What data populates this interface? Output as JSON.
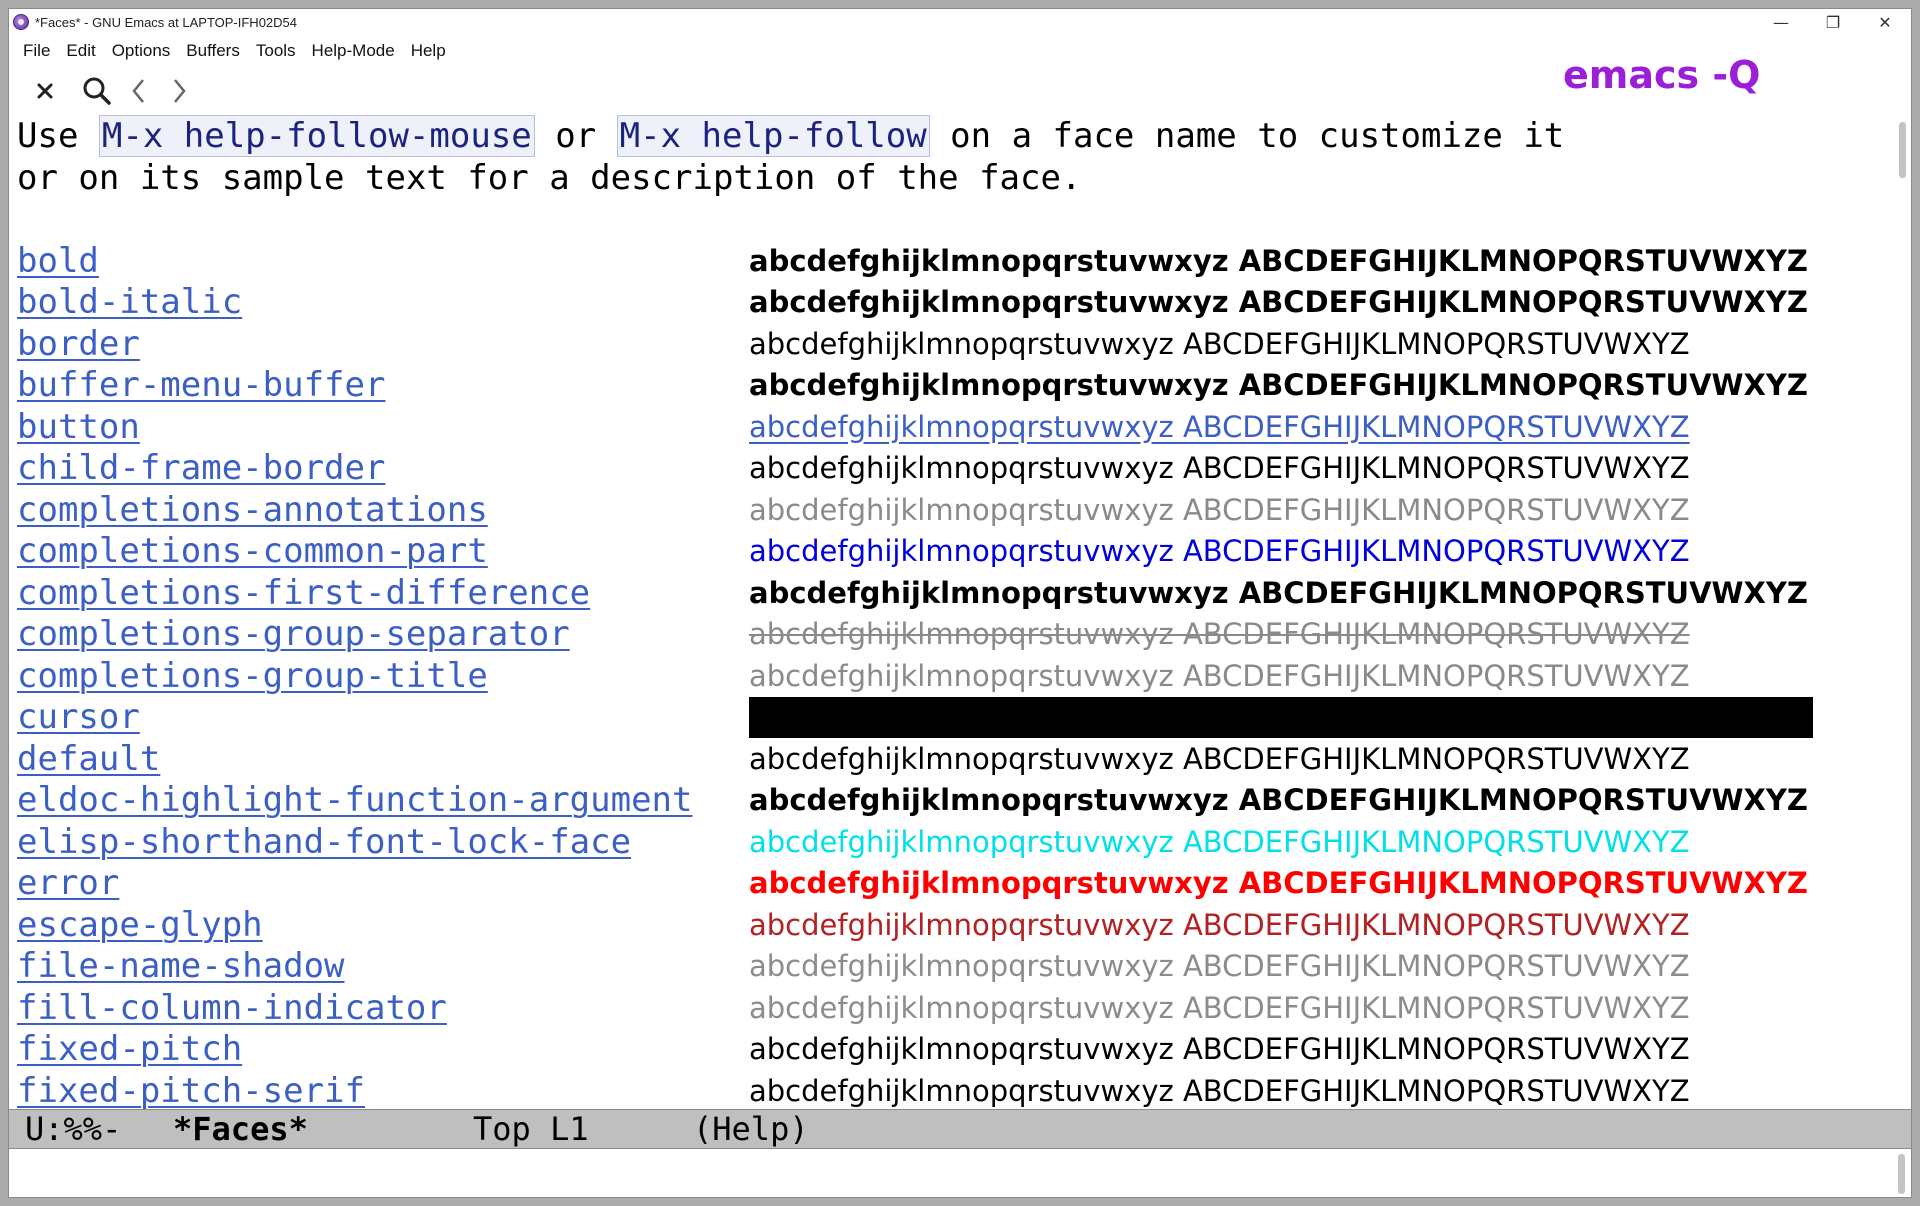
{
  "window": {
    "title": "*Faces* - GNU Emacs at LAPTOP-IFH02D54",
    "min_symbol": "—",
    "max_symbol": "❐",
    "close_symbol": "✕"
  },
  "menubar": [
    "File",
    "Edit",
    "Options",
    "Buffers",
    "Tools",
    "Help-Mode",
    "Help"
  ],
  "toolbar": {
    "icons": [
      "close-icon",
      "search-icon",
      "back-icon",
      "forward-icon"
    ]
  },
  "overlay_label": "emacs -Q",
  "intro": {
    "line1_a": "Use ",
    "line1_kbd1": "M-x help-follow-mouse",
    "line1_b": " or ",
    "line1_kbd2": "M-x help-follow",
    "line1_c": " on a face name to customize it",
    "line2": "or on its sample text for a description of the face."
  },
  "sample_text": "abcdefghijklmnopqrstuvwxyz ABCDEFGHIJKLMNOPQRSTUVWXYZ",
  "faces": [
    {
      "name": "bold",
      "style": "s-bold"
    },
    {
      "name": "bold-italic",
      "style": "s-bold"
    },
    {
      "name": "border",
      "style": ""
    },
    {
      "name": "buffer-menu-buffer",
      "style": "s-bold"
    },
    {
      "name": "button",
      "style": "s-link"
    },
    {
      "name": "child-frame-border",
      "style": ""
    },
    {
      "name": "completions-annotations",
      "style": "s-grey"
    },
    {
      "name": "completions-common-part",
      "style": "s-blue"
    },
    {
      "name": "completions-first-difference",
      "style": "s-bold"
    },
    {
      "name": "completions-group-separator",
      "style": "s-strike"
    },
    {
      "name": "completions-group-title",
      "style": "s-grey"
    },
    {
      "name": "cursor",
      "style": "s-cursor"
    },
    {
      "name": "default",
      "style": ""
    },
    {
      "name": "eldoc-highlight-function-argument",
      "style": "s-bold"
    },
    {
      "name": "elisp-shorthand-font-lock-face",
      "style": "s-cyan"
    },
    {
      "name": "error",
      "style": "s-red s-bold"
    },
    {
      "name": "escape-glyph",
      "style": "s-darkred"
    },
    {
      "name": "file-name-shadow",
      "style": "s-lightgrey"
    },
    {
      "name": "fill-column-indicator",
      "style": "s-lightgrey"
    },
    {
      "name": "fixed-pitch",
      "style": ""
    },
    {
      "name": "fixed-pitch-serif",
      "style": ""
    }
  ],
  "modeline": {
    "status": "U:%%-",
    "buffer": "*Faces*",
    "position": "Top L1",
    "mode": "(Help)"
  }
}
